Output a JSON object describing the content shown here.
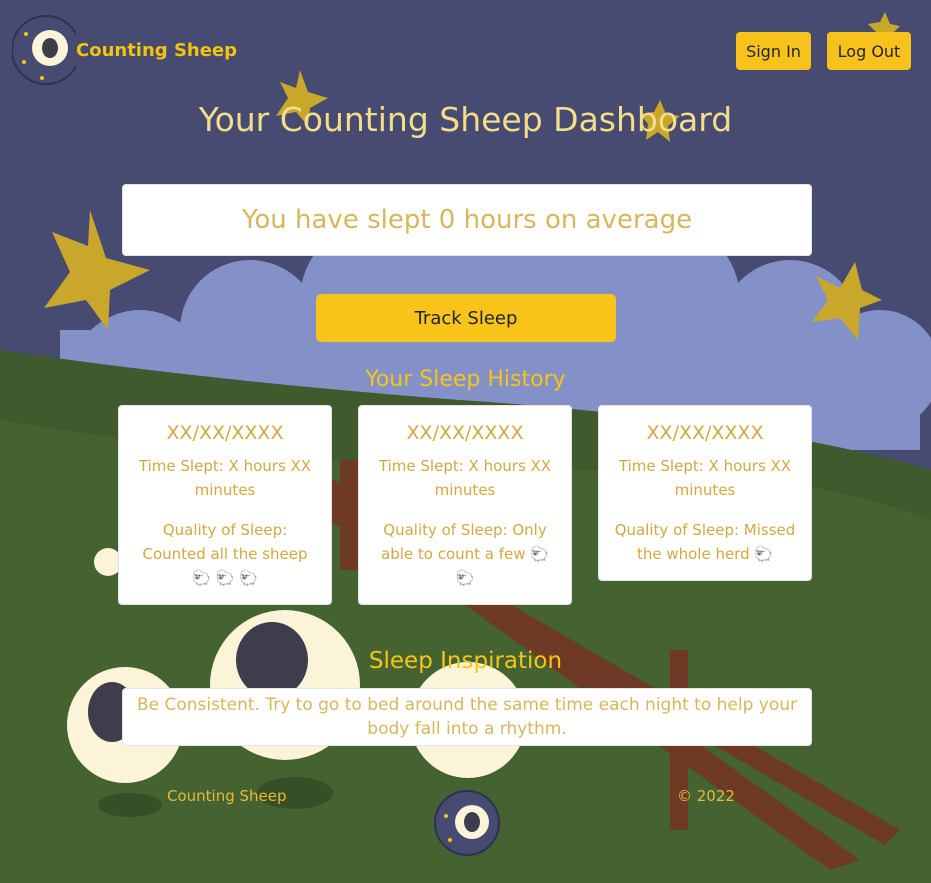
{
  "header": {
    "brand": "Counting Sheep",
    "sign_in": "Sign In",
    "log_out": "Log Out"
  },
  "main": {
    "title": "Your Counting Sheep Dashboard",
    "average": "You have slept 0 hours on average",
    "track_button": "Track Sleep",
    "history_title": "Your Sleep History",
    "history": [
      {
        "date": "XX/XX/XXXX",
        "time": [
          "Time Slept: X hours XX",
          "minutes"
        ],
        "quality": [
          "Quality of Sleep:",
          "Counted all the sheep",
          "🐑 🐑 🐑"
        ]
      },
      {
        "date": "XX/XX/XXXX",
        "time": [
          "Time Slept: X hours XX",
          "minutes"
        ],
        "quality": [
          "Quality of Sleep: Only",
          "able to count a few 🐑",
          "🐑"
        ]
      },
      {
        "date": "XX/XX/XXXX",
        "time": [
          "Time Slept: X hours XX",
          "minutes"
        ],
        "quality": [
          "Quality of Sleep: Missed",
          "the whole herd 🐑"
        ]
      }
    ],
    "inspiration_title": "Sleep Inspiration",
    "inspiration_lines": [
      "Be Consistent. Try to go to bed around the same time each night to help your",
      "body fall into a rhythm."
    ]
  },
  "footer": {
    "left": "Counting Sheep",
    "right": "© 2022"
  },
  "icons": [
    "sheep-logo-icon",
    "star-icon",
    "sheep-icon"
  ],
  "colors": {
    "background": "#474a71",
    "accent": "#f7c21b",
    "title_text": "#f2dd89",
    "card_text": "#d2a93e",
    "cloud": "#8491c9",
    "grass": "#3f5a2c"
  }
}
